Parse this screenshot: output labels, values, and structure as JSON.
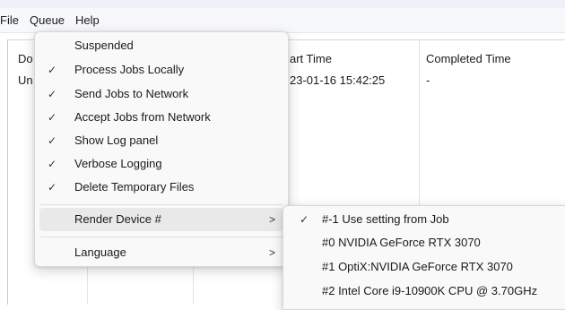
{
  "menubar": {
    "items": [
      "File",
      "Queue",
      "Help"
    ]
  },
  "table": {
    "headers": [
      "Do",
      "art Time",
      "Completed Time"
    ],
    "row": [
      "Un",
      "23-01-16 15:42:25",
      "-"
    ]
  },
  "queue_menu": {
    "items": [
      {
        "label": "Suspended",
        "checked": false
      },
      {
        "label": "Process Jobs Locally",
        "checked": true
      },
      {
        "label": "Send Jobs to Network",
        "checked": true
      },
      {
        "label": "Accept Jobs from Network",
        "checked": true
      },
      {
        "label": "Show Log panel",
        "checked": true
      },
      {
        "label": "Verbose Logging",
        "checked": true
      },
      {
        "label": "Delete Temporary Files",
        "checked": true
      }
    ],
    "render_device": {
      "label": "Render Device #",
      "arrow": ">"
    },
    "language": {
      "label": "Language",
      "arrow": ">"
    }
  },
  "render_device_menu": {
    "items": [
      {
        "label": "#-1 Use setting from Job",
        "checked": true
      },
      {
        "label": "#0 NVIDIA GeForce RTX 3070",
        "checked": false
      },
      {
        "label": "#1 OptiX:NVIDIA GeForce RTX 3070",
        "checked": false
      },
      {
        "label": "#2 Intel Core i9-10900K CPU @ 3.70GHz",
        "checked": false
      }
    ]
  },
  "check_glyph": "✓"
}
